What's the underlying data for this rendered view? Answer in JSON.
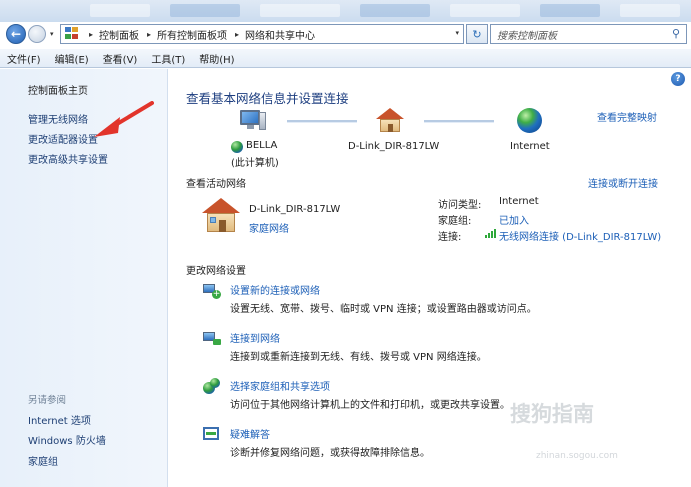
{
  "address_bar": {
    "segments": [
      "控制面板",
      "所有控制面板项",
      "网络和共享中心"
    ],
    "search_placeholder": "搜索控制面板"
  },
  "menu": [
    "文件(F)",
    "编辑(E)",
    "查看(V)",
    "工具(T)",
    "帮助(H)"
  ],
  "left_pane": {
    "home": "控制面板主页",
    "items": [
      "管理无线网络",
      "更改适配器设置",
      "更改高级共享设置"
    ],
    "see_also_title": "另请参阅",
    "see_also": [
      "Internet 选项",
      "Windows 防火墙",
      "家庭组"
    ]
  },
  "main": {
    "title": "查看基本网络信息并设置连接",
    "full_map_link": "查看完整映射",
    "map": {
      "computer_name": "BELLA",
      "computer_sub": "(此计算机)",
      "router": "D-Link_DIR-817LW",
      "internet": "Internet"
    },
    "active_title": "查看活动网络",
    "connect_link": "连接或断开连接",
    "active_network": {
      "name": "D-Link_DIR-817LW",
      "type": "家庭网络",
      "access_type_label": "访问类型:",
      "access_type_value": "Internet",
      "homegroup_label": "家庭组:",
      "homegroup_value": "已加入",
      "connection_label": "连接:",
      "connection_value": "无线网络连接 (D-Link_DIR-817LW)"
    },
    "change_title": "更改网络设置",
    "tasks": [
      {
        "title": "设置新的连接或网络",
        "desc": "设置无线、宽带、拨号、临时或 VPN 连接；或设置路由器或访问点。"
      },
      {
        "title": "连接到网络",
        "desc": "连接到或重新连接到无线、有线、拨号或 VPN 网络连接。"
      },
      {
        "title": "选择家庭组和共享选项",
        "desc": "访问位于其他网络计算机上的文件和打印机，或更改共享设置。"
      },
      {
        "title": "疑难解答",
        "desc": "诊断并修复网络问题，或获得故障排除信息。"
      }
    ]
  },
  "watermark": {
    "main": "搜狗指南",
    "sub": "zhinan.sogou.com"
  }
}
